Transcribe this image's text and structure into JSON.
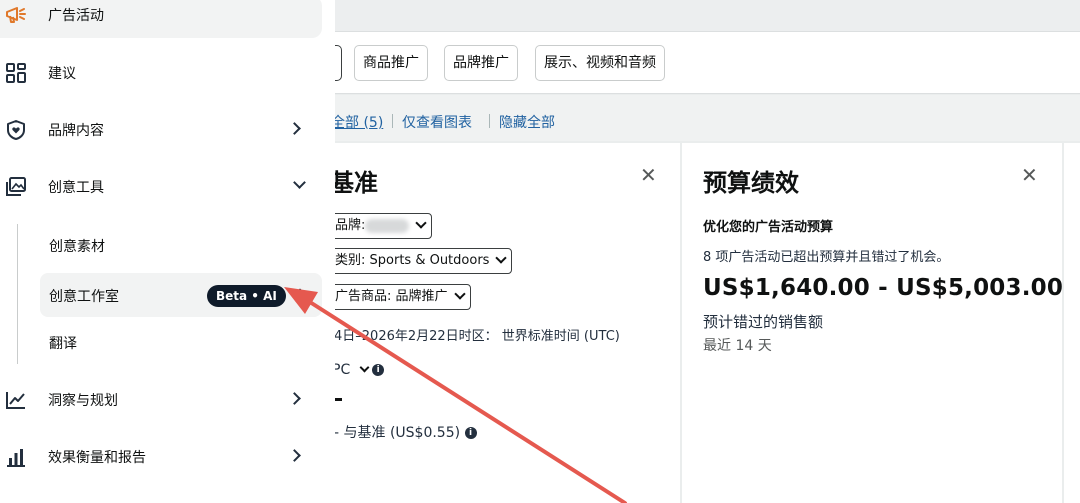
{
  "sidebar": {
    "items": [
      {
        "label": "广告活动",
        "icon": "megaphone-icon"
      },
      {
        "label": "建议",
        "icon": "grid-icon"
      },
      {
        "label": "品牌内容",
        "icon": "shield-heart-icon"
      },
      {
        "label": "创意工具",
        "icon": "image-icon"
      },
      {
        "label": "洞察与规划",
        "icon": "trend-chart-icon"
      },
      {
        "label": "效果衡量和报告",
        "icon": "bar-chart-icon"
      }
    ],
    "sub_items": [
      {
        "label": "创意素材"
      },
      {
        "label": "创意工作室",
        "badge": "Beta • AI"
      },
      {
        "label": "翻译"
      }
    ]
  },
  "toolbar": {
    "tabs": [
      "商品推广",
      "品牌推广",
      "展示、视频和音频"
    ]
  },
  "links": {
    "show_all": "全部 (5)",
    "charts_only": "仅查看图表",
    "hide_all": "隐藏全部"
  },
  "left_card": {
    "title": "基准",
    "brand_label": "品牌:",
    "category_label": "类别: Sports & Outdoors",
    "ad_product_label": "广告商品: 品牌推广",
    "date_range": "4日–2026年2月22日时区： 世界标准时间 (UTC)",
    "metric": "PC",
    "compare": "- 与基准 (US$0.55)"
  },
  "right_card": {
    "title": "预算绩效",
    "subtitle": "优化您的广告活动预算",
    "description": "8 项广告活动已超出预算并且错过了机会。",
    "amount": "US$1,640.00 - US$5,003.00",
    "note": "预计错过的销售额",
    "period": "最近 14 天"
  },
  "colors": {
    "link": "#2162a1",
    "badge_bg": "#0f1b2a",
    "annotation_arrow": "#e5594f"
  }
}
